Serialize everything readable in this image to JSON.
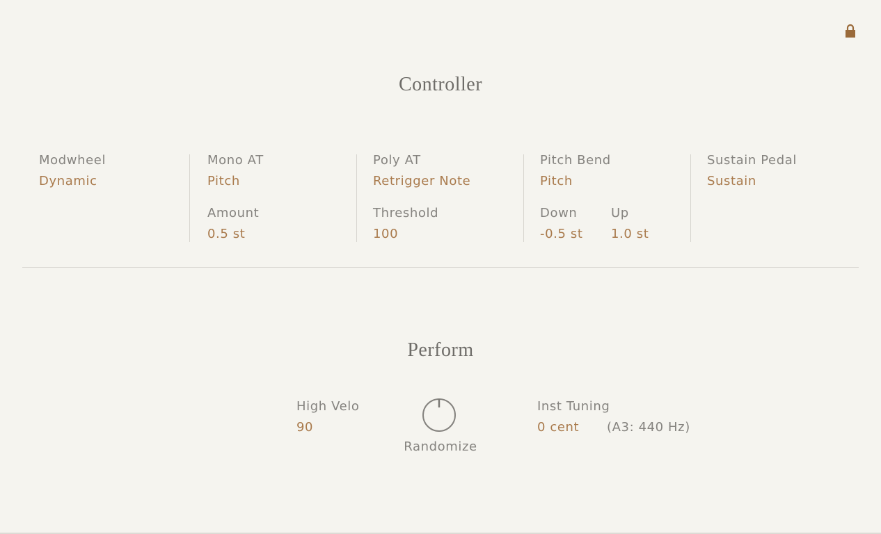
{
  "controller": {
    "title": "Controller",
    "modwheel": {
      "label": "Modwheel",
      "value": "Dynamic"
    },
    "mono_at": {
      "label": "Mono AT",
      "value": "Pitch",
      "sub_label": "Amount",
      "sub_value": "0.5 st"
    },
    "poly_at": {
      "label": "Poly AT",
      "value": "Retrigger Note",
      "sub_label": "Threshold",
      "sub_value": "100"
    },
    "pitch_bend": {
      "label": "Pitch Bend",
      "value": "Pitch",
      "down_label": "Down",
      "down_value": "-0.5 st",
      "up_label": "Up",
      "up_value": "1.0 st"
    },
    "sustain_pedal": {
      "label": "Sustain Pedal",
      "value": "Sustain"
    }
  },
  "perform": {
    "title": "Perform",
    "high_velo": {
      "label": "High Velo",
      "value": "90"
    },
    "randomize": {
      "label": "Randomize"
    },
    "inst_tuning": {
      "label": "Inst Tuning",
      "value": "0 cent",
      "reference": "(A3: 440 Hz)"
    }
  },
  "icons": {
    "lock": "lock-icon",
    "randomize_knob": "knob-icon"
  },
  "colors": {
    "background": "#f5f4ef",
    "label": "#85837f",
    "value_accent": "#a97a4c",
    "lock": "#9a6a3a"
  }
}
